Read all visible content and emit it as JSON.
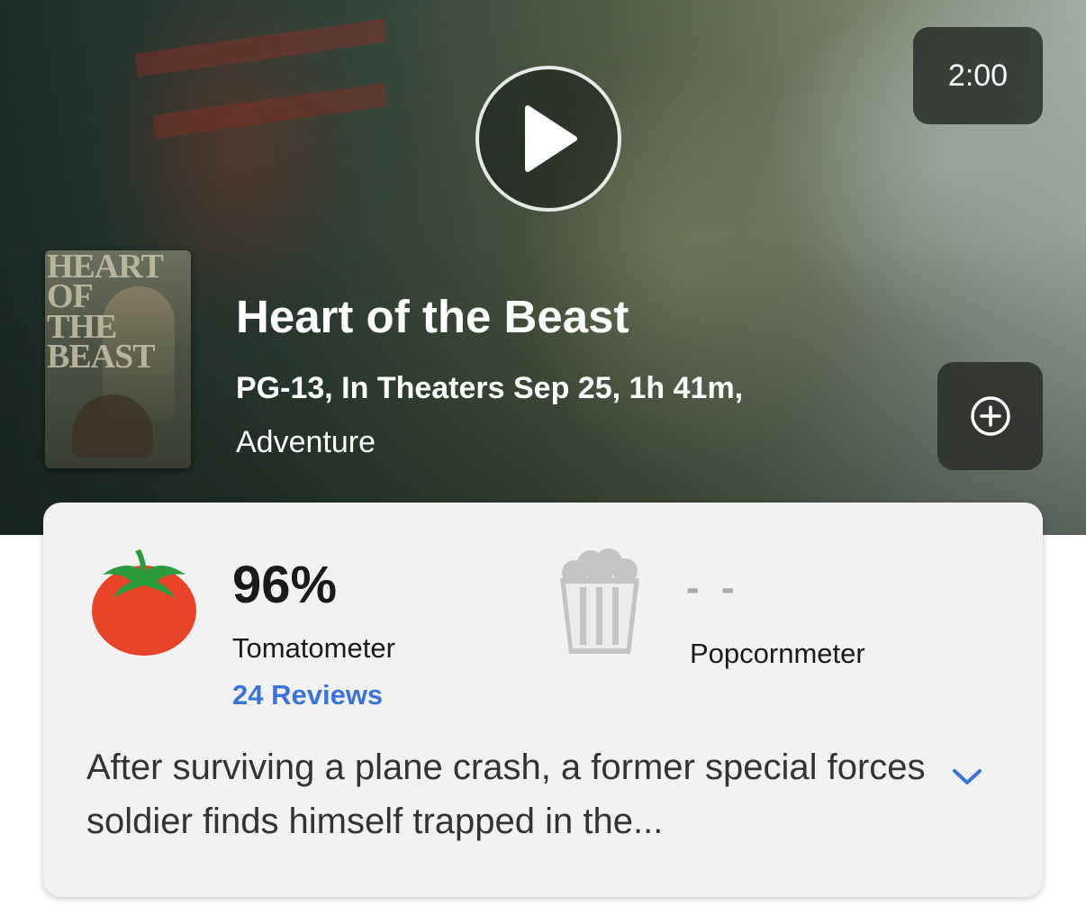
{
  "video": {
    "duration": "2:00",
    "play_icon": "play-icon"
  },
  "movie": {
    "title": "Heart of the Beast",
    "meta": "PG-13, In Theaters Sep 25, 1h 41m,",
    "genre": "Adventure",
    "poster_title": "HEART\nOF\nTHE\nBEAST",
    "add_icon": "plus-circle-icon"
  },
  "ratings": {
    "tomatometer": {
      "score": "96%",
      "label": "Tomatometer",
      "reviews": "24 Reviews",
      "icon": "tomato-icon",
      "color": "#e8442a"
    },
    "popcornmeter": {
      "score": "- -",
      "label": "Popcornmeter",
      "icon": "popcorn-bucket-icon"
    }
  },
  "synopsis": {
    "text": "After surviving a plane crash, a former special forces soldier finds himself trapped in the...",
    "expand_icon": "chevron-down-icon"
  },
  "colors": {
    "link": "#3c73d8",
    "card_bg": "#f2f2f2"
  }
}
